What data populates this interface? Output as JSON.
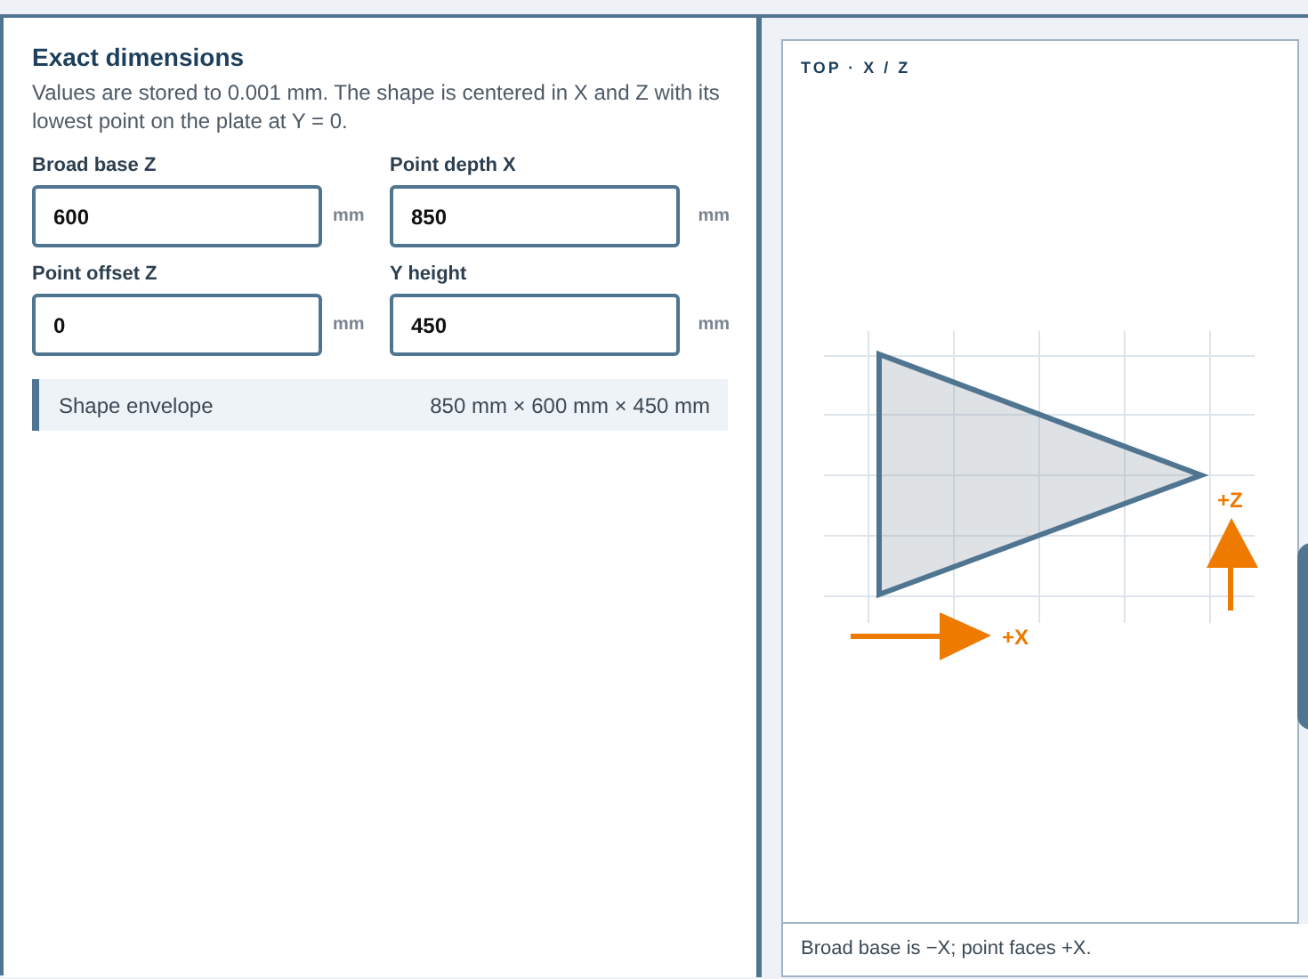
{
  "dimensions": {
    "title": "Exact dimensions",
    "description": "Values are stored to 0.001 mm. The shape is centered in X and Z with its lowest point on the plate at Y = 0.",
    "fields": [
      {
        "label": "Broad base Z",
        "value": "600",
        "unit": "mm"
      },
      {
        "label": "Point depth X",
        "value": "850",
        "unit": "mm"
      },
      {
        "label": "Point offset Z",
        "value": "0",
        "unit": "mm"
      },
      {
        "label": "Y height",
        "value": "450",
        "unit": "mm"
      }
    ],
    "envelope": {
      "label": "Shape envelope",
      "value": "850 mm × 600 mm × 450 mm"
    }
  },
  "preview": {
    "title": "TOP · X / Z",
    "x_axis_label": "+X",
    "z_axis_label": "+Z",
    "caption": "Broad base is −X; point faces +X."
  }
}
